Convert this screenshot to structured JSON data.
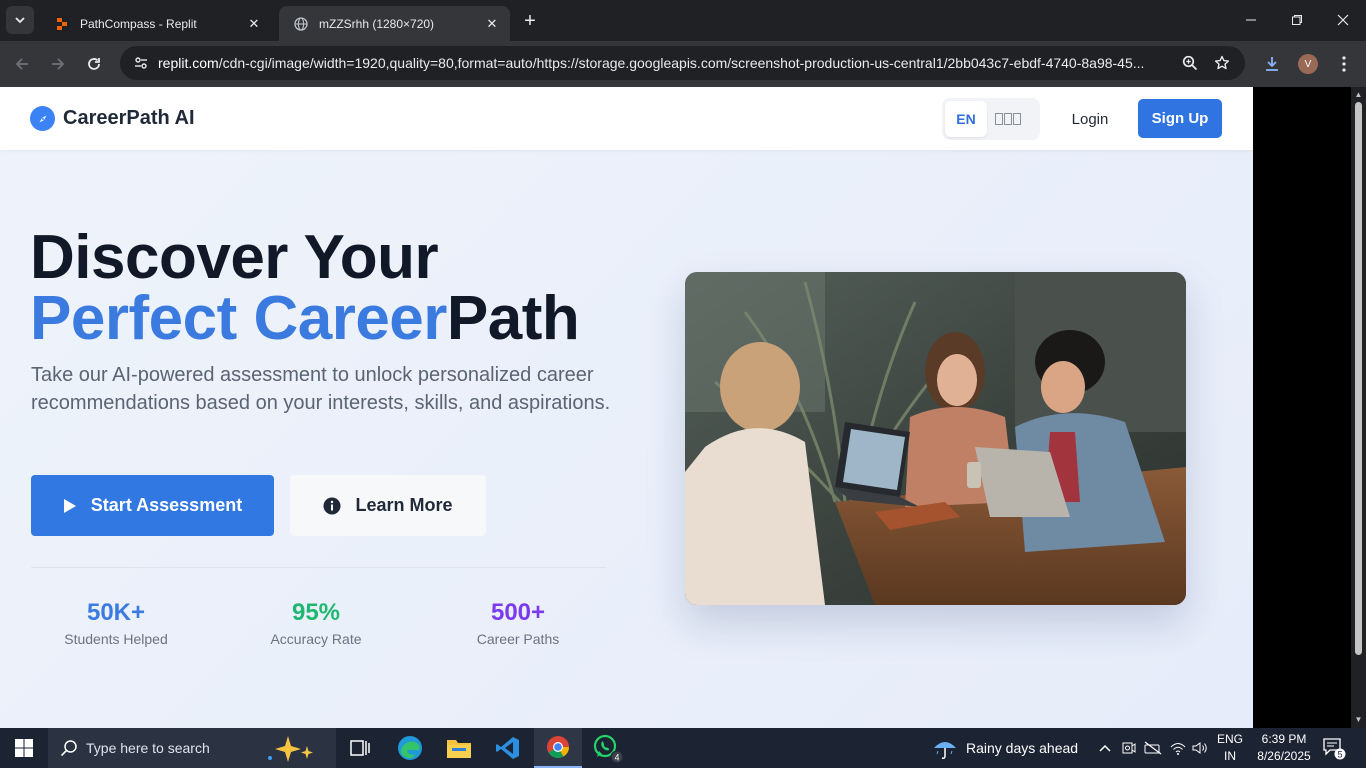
{
  "browser": {
    "tabs": [
      {
        "title": "PathCompass - Replit",
        "active": false
      },
      {
        "title": "mZZSrhh (1280×720)",
        "active": true
      }
    ],
    "new_tab": "+",
    "url_prefix": "replit.com",
    "url_rest": "/cdn-cgi/image/width=1920,quality=80,format=auto/https://storage.googleapis.com/screenshot-production-us-central1/2bb043c7-ebdf-4740-8a98-45...",
    "profile_initial": "V"
  },
  "site": {
    "brand": "CareerPath AI",
    "lang": {
      "en": "EN",
      "other": "한국어"
    },
    "login": "Login",
    "signup": "Sign Up"
  },
  "hero": {
    "title_line1": "Discover Your",
    "title_accent": "Perfect Career",
    "title_rest": "Path",
    "description": "Take our AI-powered assessment to unlock personalized career recommendations based on your interests, skills, and aspirations.",
    "primary_cta": "Start Assessment",
    "secondary_cta": "Learn More",
    "stats": [
      {
        "value": "50K+",
        "label": "Students Helped",
        "color": "#3b7be0"
      },
      {
        "value": "95%",
        "label": "Accuracy Rate",
        "color": "#1fb870"
      },
      {
        "value": "500+",
        "label": "Career Paths",
        "color": "#7c3aed"
      }
    ]
  },
  "taskbar": {
    "search_placeholder": "Type here to search",
    "weather": "Rainy days ahead",
    "input_lang_top": "ENG",
    "input_lang_bottom": "IN",
    "time": "6:39 PM",
    "date": "8/26/2025",
    "notification_count": "5",
    "whatsapp_badge": "4"
  },
  "colors": {
    "accent": "#3b7be0",
    "primary_button": "#3278e3"
  }
}
